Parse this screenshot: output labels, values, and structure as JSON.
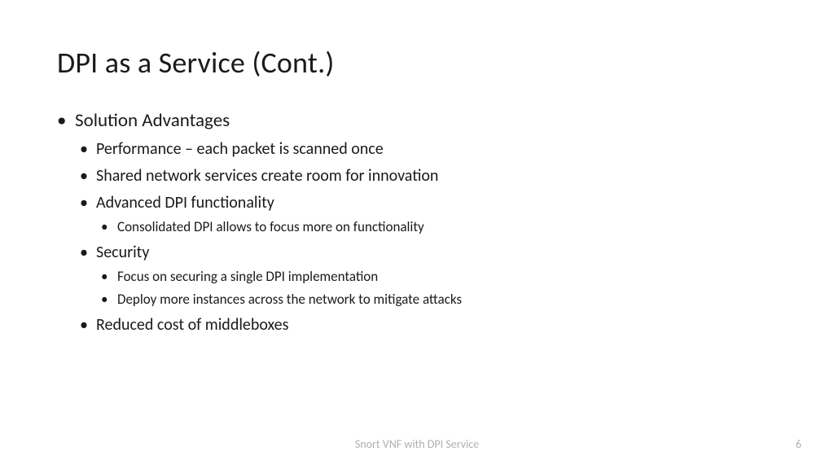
{
  "title": "DPI as a Service (Cont.)",
  "content": {
    "heading": "Solution Advantages",
    "items": [
      {
        "text": "Performance – each packet is scanned once"
      },
      {
        "text": "Shared network services create room for innovation"
      },
      {
        "text": "Advanced DPI functionality",
        "children": [
          {
            "text": "Consolidated DPI allows to focus more on functionality"
          }
        ]
      },
      {
        "text": "Security",
        "children": [
          {
            "text": "Focus on securing a single DPI implementation"
          },
          {
            "text": "Deploy more instances across the network to mitigate attacks"
          }
        ]
      },
      {
        "text": "Reduced cost of middleboxes"
      }
    ]
  },
  "footer": "Snort VNF with DPI Service",
  "page_number": "6"
}
